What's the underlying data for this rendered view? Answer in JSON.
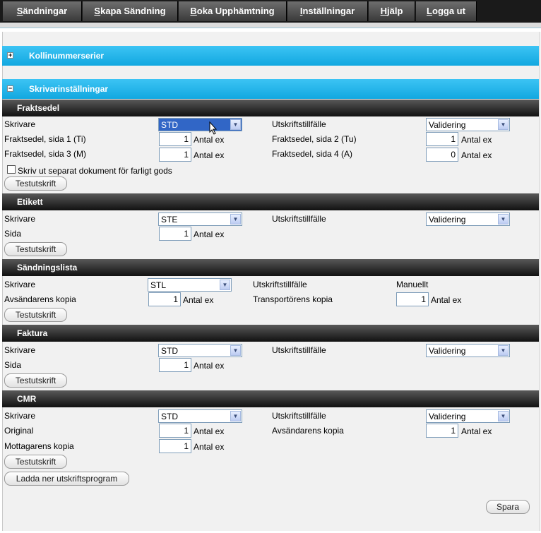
{
  "nav": {
    "items": [
      {
        "label": "Sändningar"
      },
      {
        "label": "Skapa Sändning"
      },
      {
        "label": "Boka Upphämtning"
      },
      {
        "label": "Inställningar"
      },
      {
        "label": "Hjälp"
      },
      {
        "label": "Logga ut"
      }
    ]
  },
  "bands": {
    "kollinummer": "Kollinummerserier",
    "skrivarinst": "Skrivarinställningar"
  },
  "common": {
    "antal_ex": "Antal ex",
    "testutskrift": "Testutskrift",
    "skrivare": "Skrivare",
    "utskriftstillfalle": "Utskriftstillfälle"
  },
  "fraktsedel": {
    "title": "Fraktsedel",
    "printer": "STD",
    "occasion": "Validering",
    "page1_label": "Fraktsedel, sida 1 (Ti)",
    "page1_value": "1",
    "page2_label": "Fraktsedel, sida 2 (Tu)",
    "page2_value": "1",
    "page3_label": "Fraktsedel, sida 3 (M)",
    "page3_value": "1",
    "page4_label": "Fraktsedel, sida 4 (A)",
    "page4_value": "0",
    "dangerous_goods_label": "Skriv ut separat dokument för farligt gods"
  },
  "etikett": {
    "title": "Etikett",
    "printer": "STE",
    "occasion": "Validering",
    "page_label": "Sida",
    "page_value": "1"
  },
  "sandningslista": {
    "title": "Sändningslista",
    "printer": "STL",
    "occasion": "Manuellt",
    "sender_copy_label": "Avsändarens kopia",
    "sender_copy_value": "1",
    "carrier_copy_label": "Transportörens kopia",
    "carrier_copy_value": "1"
  },
  "faktura": {
    "title": "Faktura",
    "printer": "STD",
    "occasion": "Validering",
    "page_label": "Sida",
    "page_value": "1"
  },
  "cmr": {
    "title": "CMR",
    "printer": "STD",
    "occasion": "Validering",
    "original_label": "Original",
    "original_value": "1",
    "sender_copy_label": "Avsändarens kopia",
    "sender_copy_value": "1",
    "receiver_copy_label": "Mottagarens kopia",
    "receiver_copy_value": "1"
  },
  "actions": {
    "download_label": "Ladda ner utskriftsprogram",
    "save_label": "Spara"
  }
}
